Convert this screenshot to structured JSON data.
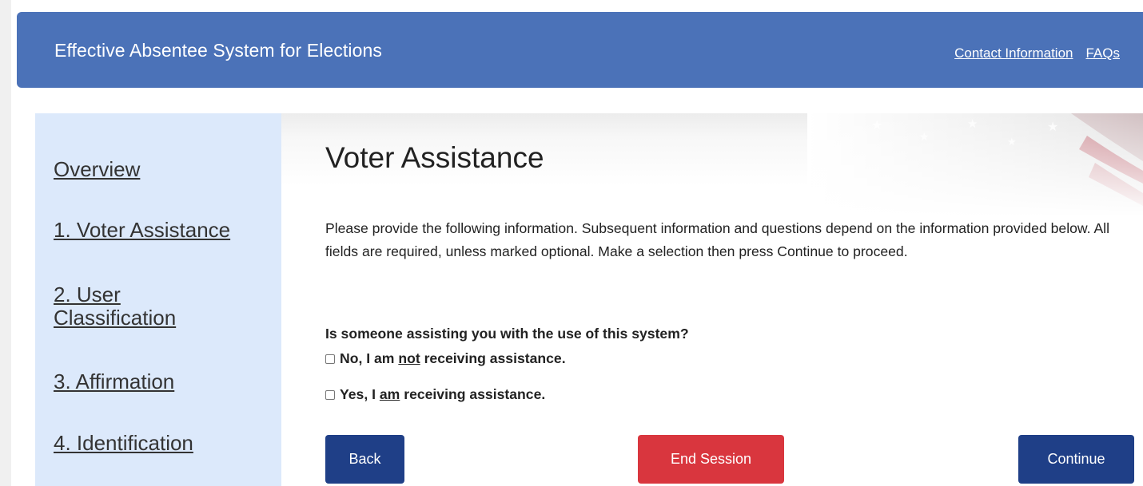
{
  "header": {
    "title": "Effective Absentee System for Elections",
    "links": {
      "contact": "Contact Information",
      "faqs": "FAQs"
    }
  },
  "sidebar": {
    "items": [
      {
        "label": "Overview"
      },
      {
        "label": "1. Voter Assistance"
      },
      {
        "label": "2. User Classification"
      },
      {
        "label": "3. Affirmation"
      },
      {
        "label": "4. Identification"
      }
    ]
  },
  "main": {
    "title": "Voter Assistance",
    "intro": "Please provide the following information. Subsequent information and questions depend on the information provided below. All fields are required, unless marked optional. Make a selection then press Continue to proceed.",
    "question": "Is someone assisting you with the use of this system?",
    "options": [
      {
        "before": "No, I am ",
        "emph": "not",
        "after": " receiving assistance.",
        "checked": false
      },
      {
        "before": "Yes, I ",
        "emph": "am",
        "after": " receiving assistance.",
        "checked": false
      }
    ]
  },
  "buttons": {
    "back": "Back",
    "end_session": "End Session",
    "continue": "Continue"
  },
  "colors": {
    "header_bg": "#4b72b8",
    "sidebar_bg": "#dce9fb",
    "primary_button": "#1f3f87",
    "danger_button": "#d9363e"
  }
}
